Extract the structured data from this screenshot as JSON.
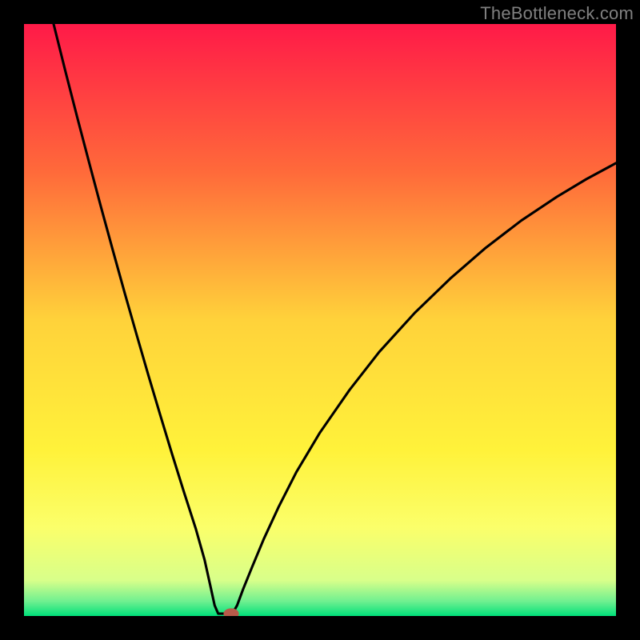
{
  "watermark": "TheBottleneck.com",
  "chart_data": {
    "type": "line",
    "title": "",
    "xlabel": "",
    "ylabel": "",
    "xlim": [
      0,
      100
    ],
    "ylim": [
      0,
      100
    ],
    "grid": false,
    "legend": false,
    "background_gradient_stops": [
      {
        "offset": 0.0,
        "color": "#ff1a48"
      },
      {
        "offset": 0.25,
        "color": "#ff6a3a"
      },
      {
        "offset": 0.5,
        "color": "#ffd23a"
      },
      {
        "offset": 0.72,
        "color": "#fff23a"
      },
      {
        "offset": 0.85,
        "color": "#fbff6a"
      },
      {
        "offset": 0.94,
        "color": "#d8ff8a"
      },
      {
        "offset": 0.975,
        "color": "#70f090"
      },
      {
        "offset": 1.0,
        "color": "#00e07a"
      }
    ],
    "series": [
      {
        "name": "left-curve",
        "x": [
          5,
          7,
          9,
          11,
          13,
          15,
          17,
          19,
          21,
          23,
          25,
          27,
          29,
          30.5,
          31.5,
          32.2,
          32.8
        ],
        "y": [
          100,
          92,
          84.2,
          76.6,
          69.1,
          61.8,
          54.6,
          47.6,
          40.7,
          34,
          27.4,
          21,
          14.8,
          9.5,
          5,
          1.8,
          0.4
        ]
      },
      {
        "name": "valley-flat",
        "x": [
          32.8,
          35.2
        ],
        "y": [
          0.4,
          0.4
        ]
      },
      {
        "name": "right-curve",
        "x": [
          35.2,
          36,
          37,
          38.5,
          40.5,
          43,
          46,
          50,
          55,
          60,
          66,
          72,
          78,
          84,
          90,
          95,
          100
        ],
        "y": [
          0.4,
          1.8,
          4.5,
          8.2,
          13,
          18.4,
          24.3,
          31,
          38.2,
          44.6,
          51.2,
          57,
          62.2,
          66.8,
          70.8,
          73.8,
          76.5
        ]
      }
    ],
    "marker": {
      "name": "valley-marker",
      "x": 35.0,
      "y": 0.4,
      "color": "#b85a4a",
      "rx": 1.3,
      "ry": 0.9
    }
  }
}
